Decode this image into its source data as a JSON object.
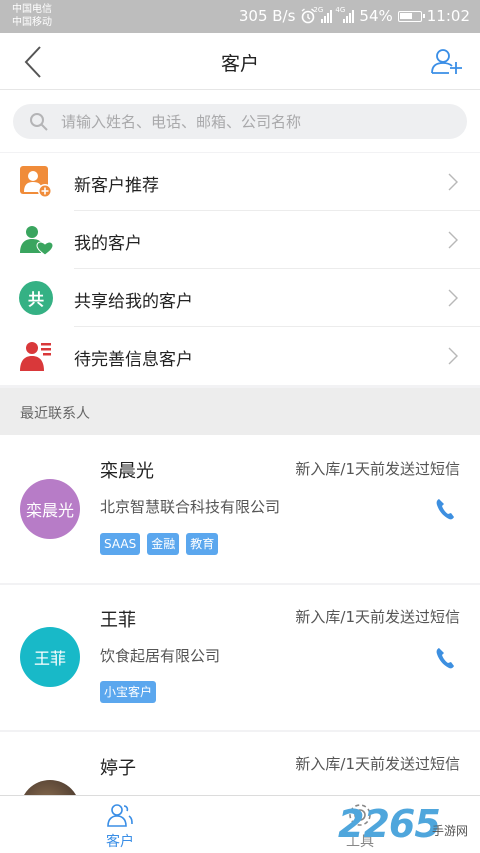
{
  "status_bar": {
    "carrier1": "中国电信",
    "carrier2": "中国移动",
    "speed": "305 B/s",
    "battery": "54%",
    "time": "11:02",
    "signal1": "2G",
    "signal2": "4G"
  },
  "header": {
    "title": "客户"
  },
  "search": {
    "placeholder": "请输入姓名、电话、邮箱、公司名称"
  },
  "menu": [
    {
      "label": "新客户推荐",
      "icon": "new-customer-icon",
      "color": "#f08c3a"
    },
    {
      "label": "我的客户",
      "icon": "my-customers-icon",
      "color": "#3aa55f"
    },
    {
      "label": "共享给我的客户",
      "icon": "shared-icon",
      "icon_text": "共",
      "color": "#35b184"
    },
    {
      "label": "待完善信息客户",
      "icon": "incomplete-info-icon",
      "color": "#d9383a"
    }
  ],
  "section": {
    "recent_contacts": "最近联系人"
  },
  "contacts": [
    {
      "name": "栾晨光",
      "avatar_text": "栾晨光",
      "avatar_color": "#b77cc7",
      "status": "新入库/1天前发送过短信",
      "company": "北京智慧联合科技有限公司",
      "tags": [
        "SAAS",
        "金融",
        "教育"
      ]
    },
    {
      "name": "王菲",
      "avatar_text": "王菲",
      "avatar_color": "#18b9c8",
      "status": "新入库/1天前发送过短信",
      "company": "饮食起居有限公司",
      "tags": [
        "小宝客户"
      ]
    },
    {
      "name": "婷子",
      "avatar_text": "",
      "avatar_color": "#5a4636",
      "status": "新入库/1天前发送过短信",
      "company": "",
      "tags": []
    }
  ],
  "tabs": {
    "customers": "客户",
    "tools": "工具"
  },
  "watermark": {
    "number": "2265",
    "text": "手游网"
  },
  "colors": {
    "accent": "#3a8ee6",
    "tag_bg": "#5ba7ee",
    "phone": "#3d8fe0"
  }
}
